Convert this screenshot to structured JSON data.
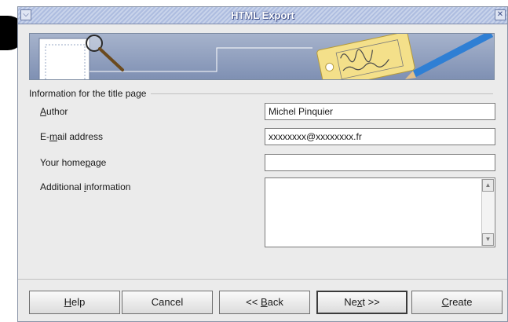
{
  "window": {
    "title": "HTML Export",
    "menu_icon": "chevron-down-icon",
    "close_icon": "close-icon"
  },
  "banner": {
    "icons": [
      "magnifier-icon",
      "tag-icon",
      "pencil-icon"
    ]
  },
  "section": {
    "title": "Information for the title page"
  },
  "fields": {
    "author": {
      "label_pre": "",
      "label_key": "A",
      "label_post": "uthor",
      "value": "Michel Pinquier"
    },
    "email": {
      "label_pre": "E-",
      "label_key": "m",
      "label_post": "ail address",
      "value": "xxxxxxxx@xxxxxxxx.fr"
    },
    "homepage": {
      "label_pre": "Your home",
      "label_key": "p",
      "label_post": "age",
      "value": ""
    },
    "info": {
      "label_pre": "Additional ",
      "label_key": "i",
      "label_post": "nformation",
      "value": ""
    }
  },
  "buttons": {
    "help": {
      "pre": "",
      "key": "H",
      "post": "elp"
    },
    "cancel": {
      "label": "Cancel"
    },
    "back": {
      "pre": "<< ",
      "key": "B",
      "post": "ack"
    },
    "next": {
      "pre": "Ne",
      "key": "x",
      "post": "t >>"
    },
    "create": {
      "pre": "",
      "key": "C",
      "post": "reate"
    }
  },
  "colors": {
    "titlebar": "#aebde0",
    "dialog_bg": "#ebebeb",
    "banner": "#8fa0c0"
  }
}
